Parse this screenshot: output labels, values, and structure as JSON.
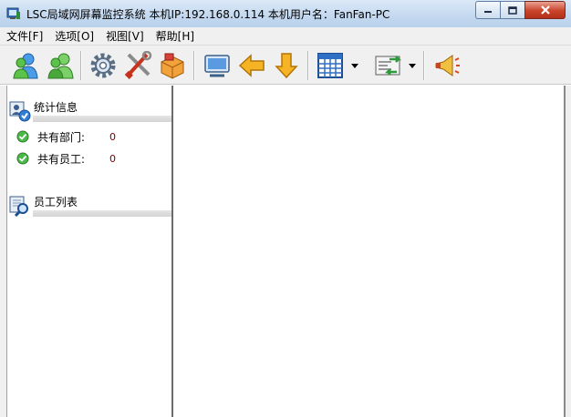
{
  "window": {
    "title": "LSC局域网屏幕监控系统    本机IP:192.168.0.114    本机用户名：FanFan-PC"
  },
  "menu": [
    {
      "label": "文件[F]"
    },
    {
      "label": "选项[O]"
    },
    {
      "label": "视图[V]"
    },
    {
      "label": "帮助[H]"
    }
  ],
  "toolbar": {
    "buttons": [
      "user-blue-icon",
      "user-green-icon",
      "gear-icon",
      "tools-icon",
      "boxes-icon",
      "monitor-icon",
      "arrow-left-icon",
      "arrow-down-icon",
      "grid-view-icon",
      "transfer-icon",
      "broadcast-icon"
    ]
  },
  "stats": {
    "title": "统计信息",
    "rows": [
      {
        "label": "共有部门:",
        "value": "0"
      },
      {
        "label": "共有员工:",
        "value": "0"
      }
    ]
  },
  "employees": {
    "title": "员工列表"
  },
  "colors": {
    "titlebar": "#c3d8ef",
    "menubar": "#f0f0f0",
    "value": "#7a0000",
    "close": "#c9432b"
  }
}
